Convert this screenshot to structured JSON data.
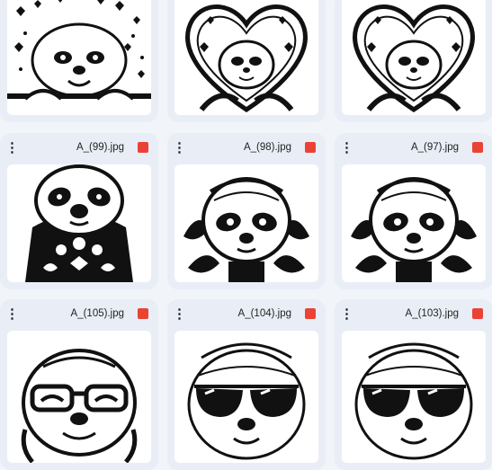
{
  "icons": {
    "more": "more-vertical-icon",
    "file_type": "image-file-icon"
  },
  "colors": {
    "file_type_badge": "#ea4335",
    "card_bg": "#e9eef6",
    "page_bg": "#f1f4f9"
  },
  "files": [
    {
      "name": "",
      "thumbnail": "sloth behind fence with hearts"
    },
    {
      "name": "",
      "thumbnail": "sloth in heart frame with floral ornaments"
    },
    {
      "name": "",
      "thumbnail": "sloth in heart frame with floral ornaments"
    },
    {
      "name": "A_(99).jpg",
      "thumbnail": "sloth with patterned sweater"
    },
    {
      "name": "A_(98).jpg",
      "thumbnail": "sloth face with leaves"
    },
    {
      "name": "A_(97).jpg",
      "thumbnail": "sloth face with leaves"
    },
    {
      "name": "A_(105).jpg",
      "thumbnail": "smiling sloth with glasses"
    },
    {
      "name": "A_(104).jpg",
      "thumbnail": "sloth with sunglasses"
    },
    {
      "name": "A_(103).jpg",
      "thumbnail": "sloth with sunglasses"
    }
  ]
}
